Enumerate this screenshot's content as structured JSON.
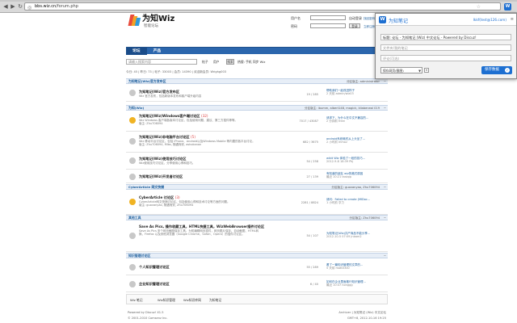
{
  "browser": {
    "url_host": "bbs.wiz.cn",
    "url_path": "/forum.php",
    "back_glyph": "◀",
    "forward_glyph": "▶",
    "reload_glyph": "↻",
    "star_glyph": "☆",
    "ext_label": "W"
  },
  "site": {
    "brand": "为知Wiz",
    "brand_sub": "智能论坛",
    "login": {
      "user_label": "用户名",
      "pass_label": "密码",
      "remember": "自动登录",
      "forgot": "找回密码",
      "login_button": "登录",
      "register": "立即注册"
    },
    "nav": [
      "论坛",
      "产品"
    ],
    "search": {
      "placeholder": "请输入搜索内容",
      "opt1": "帖子",
      "opt2": "用户",
      "button": "搜索",
      "hot": "热搜: 手机 同步 Wiz"
    },
    "stats": "今日: 45 | 昨日: 73 | 帖子: 33003 | 会员: 14390 | 欢迎新会员: Wrighg003",
    "stats_right": "最新回复"
  },
  "sections": [
    {
      "title": "为知笔记(Wiz)官方发布区",
      "mods": "分区版主: administrator",
      "forums": [
        {
          "name": "为知笔记(Wiz)官方发布区",
          "count": "",
          "desc": "Wiz 官方发布，包括新版本发布和客户端升级内容",
          "stats": "19 / 285",
          "last1": "帮助我们一起改进样子",
          "last2": "2 天前 admin/wiz03"
        }
      ]
    },
    {
      "title": "为知(Wiz)",
      "mods": "分区版主: ibumm, albert148, magick, kliaberwal 019",
      "forums": [
        {
          "name": "为知笔记(Wiz)Windows客户端讨论区",
          "count": "(32)",
          "desc": "Wiz Windows 客户端各版本讨论区，包括使用问题、建议、第三方插件等等。",
          "sub": "版主: Zhu706094",
          "stats": "7017 / 43087",
          "last1": "请求下，为什么在中文不兼容的...",
          "last2": "2 分钟前 freel"
        },
        {
          "name": "为知笔记(Wiz)非电脑平台讨论区",
          "count": "(5)",
          "desc": "Wiz 移动平台讨论区，包括 iPhone、Android以及Windows Mobile 等内置的各平台讨论。",
          "sub": "版主: Zhu706094, Mlbs, 随遇而安, ashokanan",
          "stats": "682 / 3675",
          "last1": "android系统耗时从上头坐了...",
          "last2": "2 小时前 mmo2"
        },
        {
          "name": "为知笔记(Wiz)使用技巧讨论区",
          "count": "",
          "desc": "Wiz使用技巧讨论区，分享使用心得和技巧。",
          "stats": "54 / 258",
          "last1": "wikit Wiz 体验了一段的技巧...",
          "last2": "2012-9-8 18:39 Pkj"
        },
        {
          "name": "为知笔记(Wiz)开发者讨论区",
          "count": "",
          "desc": "",
          "stats": "27 / 139",
          "last1": "有知道的朋友 wiz的格式原因",
          "last2": "最近 10:21 taskpp"
        }
      ]
    },
    {
      "title": "CyberArticle 网文快捕",
      "mods": "分区版主: guovanyao, Zhu706094",
      "forums": [
        {
          "name": "CyberArticle 讨论区",
          "count": "(3)",
          "desc": "CyberArticle网文快捕讨论区，包括使用心得和技术讨论等方面的问题。",
          "sub": "版主: guovanyao, 随遇而安, Zhu706094",
          "stats": "2281 / 8824",
          "last1": "请问：Failed to create (MIDoc...",
          "last2": "1 小时前 亨力"
        }
      ]
    },
    {
      "title": "其他工具",
      "mods": "分区版主: Zhu706094",
      "forums": [
        {
          "name": "Save As Pics, 操作收藏工具，HTML快捷工具，WizWebBrowser插件讨论区",
          "count": "",
          "desc": "Save As Pics 多个网页截图保存工具，为知编辑网页插件，网页图片保存，自动截图、HTML转换，Firefox 以及其他浏览器（Google Chrome、Safari、Opera）的插件讨论区。",
          "stats": "54 / 107",
          "last1": "为知笔记(Wiz)共产商品不能分享...",
          "last2": "2012-10-5 07:09 jnbam2"
        }
      ]
    },
    {
      "title": "知识管理讨论区",
      "mods": "",
      "forums": [
        {
          "name": "个人知识管理讨论区",
          "count": "",
          "desc": "",
          "stats": "55 / 289",
          "last1": "看了一篇知识管理的文章的...",
          "last2": "5 天前 matt0300"
        },
        {
          "name": "企业知识管理讨论区",
          "count": "",
          "desc": "",
          "stats": "6 / 40",
          "last1": "如何在企业里面推行知识管理...",
          "last2": "最近 10:47 nonggg"
        }
      ]
    }
  ],
  "links": [
    "Wiz 笔记",
    "Wiz知识管理",
    "Wiz知识库网",
    "为知笔记"
  ],
  "footer": {
    "powered": "Powered by Discuz! X1.5",
    "copy": "© 2001-2010 Comsenz Inc.",
    "archiver": "Archiver | 为知笔记 (Wiz) 中文论坛",
    "time": "GMT+8, 2012-10-16 19:25"
  },
  "popup": {
    "title": "为知笔记",
    "user": "Ikkf(test@126.com)",
    "menu_glyph": "≡",
    "title_field": "标题: 论坛 - 为知笔记 (Wiz) 中文论坛 - Powered by Discuz!",
    "tags_placeholder": "文件夹/我的笔记",
    "comment_placeholder": "评论(可选)",
    "folder": "保存网页(截图)",
    "save": "保存数据",
    "check_glyph": "✓"
  },
  "colors": {
    "accent": "#1d6fd1",
    "nav": "#2b66ad"
  }
}
